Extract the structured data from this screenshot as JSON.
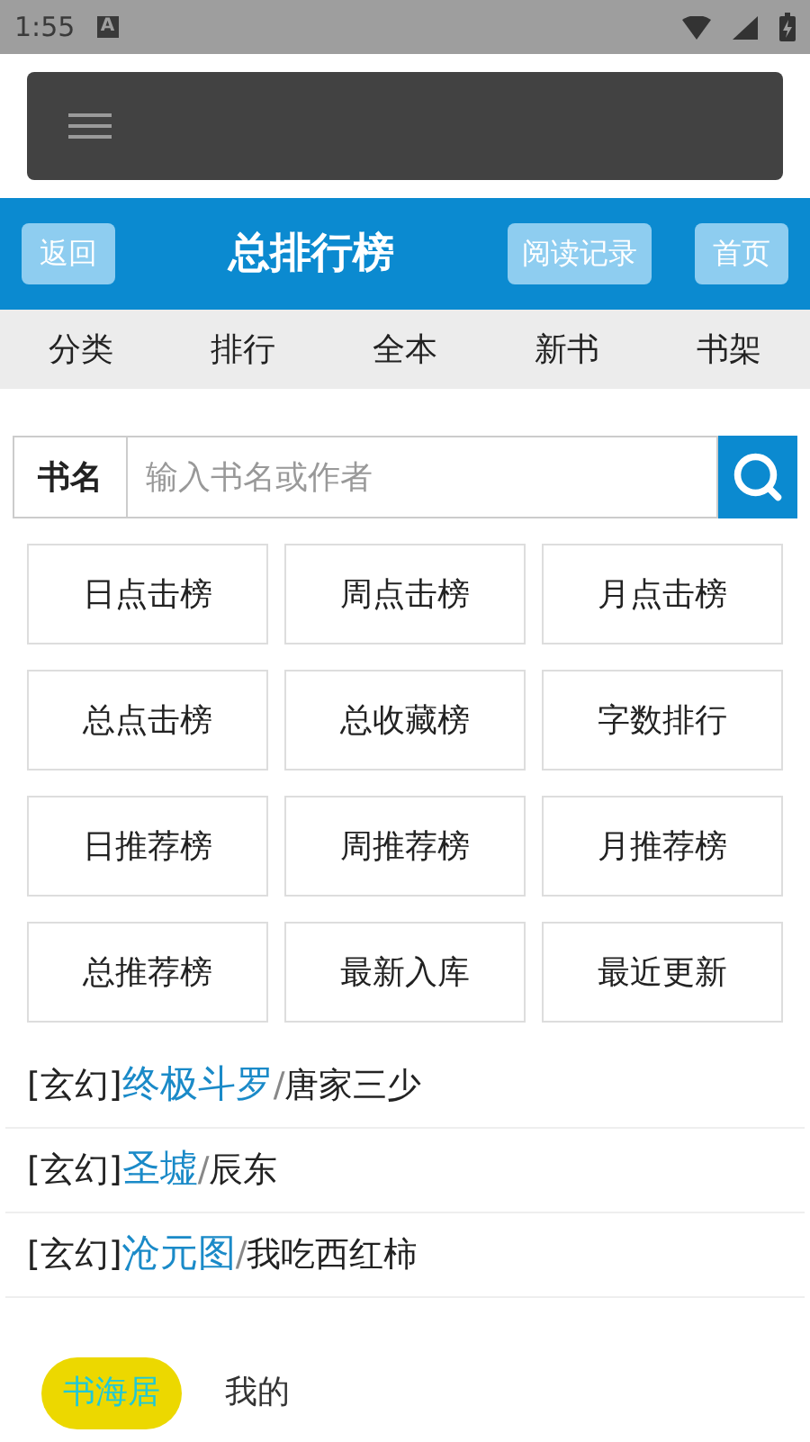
{
  "status_bar": {
    "time": "1:55",
    "notification": "A"
  },
  "header": {
    "back": "返回",
    "title": "总排行榜",
    "history": "阅读记录",
    "home": "首页"
  },
  "nav": [
    "分类",
    "排行",
    "全本",
    "新书",
    "书架"
  ],
  "search": {
    "label": "书名",
    "placeholder": "输入书名或作者"
  },
  "rankings": [
    "日点击榜",
    "周点击榜",
    "月点击榜",
    "总点击榜",
    "总收藏榜",
    "字数排行",
    "日推荐榜",
    "周推荐榜",
    "月推荐榜",
    "总推荐榜",
    "最新入库",
    "最近更新"
  ],
  "books": [
    {
      "genre": "[玄幻]",
      "title": "终极斗罗",
      "separator": "/",
      "author": "唐家三少"
    },
    {
      "genre": "[玄幻]",
      "title": "圣墟",
      "separator": "/",
      "author": "辰东"
    },
    {
      "genre": "[玄幻]",
      "title": "沧元图",
      "separator": "/",
      "author": "我吃西红柿"
    }
  ],
  "bottom_tabs": [
    {
      "label": "书海居",
      "selected": true
    },
    {
      "label": "我的",
      "selected": false
    }
  ]
}
